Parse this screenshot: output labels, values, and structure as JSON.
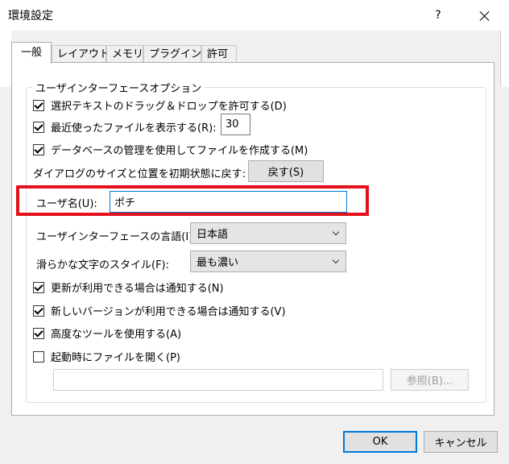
{
  "window": {
    "title": "環境設定",
    "help_label": "?",
    "close_icon": "close-icon"
  },
  "tabs": [
    {
      "label": "一般",
      "active": true
    },
    {
      "label": "レイアウト",
      "active": false
    },
    {
      "label": "メモリ",
      "active": false
    },
    {
      "label": "プラグイン",
      "active": false
    },
    {
      "label": "許可",
      "active": false
    }
  ],
  "group": {
    "title": "ユーザインターフェースオプション"
  },
  "options": {
    "drag_drop": {
      "label": "選択テキストのドラッグ＆ドロップを許可する(D)",
      "checked": true
    },
    "recent_files": {
      "label": "最近使ったファイルを表示する(R):",
      "checked": true,
      "value": "30"
    },
    "db_manage": {
      "label": "データベースの管理を使用してファイルを作成する(M)",
      "checked": true
    },
    "reset_dialog": {
      "label": "ダイアログのサイズと位置を初期状態に戻す:",
      "button": "戻す(S)"
    },
    "username": {
      "label": "ユーザ名(U):",
      "value": "ポチ"
    },
    "ui_language": {
      "label": "ユーザインターフェースの言語(I):",
      "value": "日本語"
    },
    "smooth_text": {
      "label": "滑らかな文字のスタイル(F):",
      "value": "最も濃い"
    },
    "notify_update": {
      "label": "更新が利用できる場合は通知する(N)",
      "checked": true
    },
    "notify_version": {
      "label": "新しいバージョンが利用できる場合は通知する(V)",
      "checked": true
    },
    "advanced_tools": {
      "label": "高度なツールを使用する(A)",
      "checked": true
    },
    "open_at_start": {
      "label": "起動時にファイルを開く(P)",
      "checked": false,
      "path": "",
      "browse": "参照(B)..."
    }
  },
  "footer": {
    "ok": "OK",
    "cancel": "キャンセル"
  },
  "colors": {
    "highlight_box": "#e3111b"
  }
}
